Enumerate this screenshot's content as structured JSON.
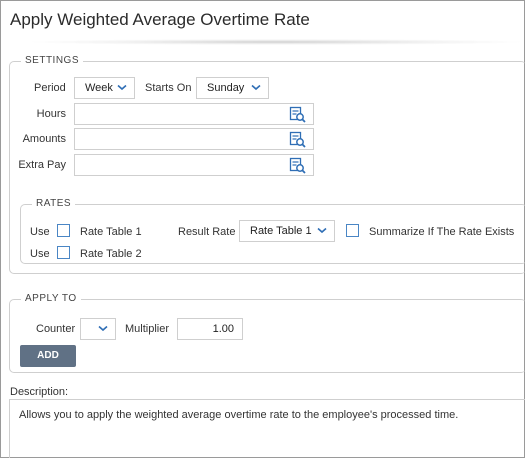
{
  "title": "Apply Weighted Average Overtime Rate",
  "settings": {
    "legend": "SETTINGS",
    "period_label": "Period",
    "period_value": "Week",
    "starts_on_label": "Starts On",
    "starts_on_value": "Sunday",
    "hours_label": "Hours",
    "amounts_label": "Amounts",
    "extra_pay_label": "Extra Pay"
  },
  "rates": {
    "legend": "RATES",
    "use_label": "Use",
    "rate_table_1": "Rate Table 1",
    "rate_table_2": "Rate Table 2",
    "result_rate_label": "Result Rate",
    "result_rate_value": "Rate Table 1",
    "summarize_label": "Summarize If The Rate Exists"
  },
  "apply_to": {
    "legend": "APPLY TO",
    "counter_label": "Counter",
    "multiplier_label": "Multiplier",
    "multiplier_value": "1.00",
    "add_button": "ADD"
  },
  "description": {
    "label": "Description:",
    "text": "Allows you to apply the weighted average overtime rate to the employee's processed time."
  },
  "colors": {
    "button_bg": "#607185",
    "checkbox_border": "#4a86c5",
    "icon_blue": "#2f6eb5"
  },
  "icons": {
    "dropdown": "chevron-down-icon",
    "lookup": "lookup-icon"
  }
}
